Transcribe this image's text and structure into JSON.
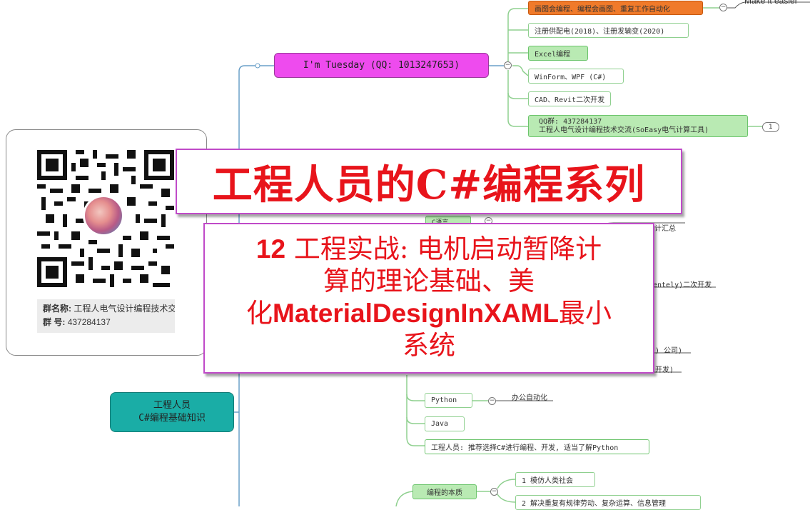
{
  "top_right_text": "Make it easier",
  "central": {
    "label": "I'm Tuesday (QQ: 1013247653)",
    "color": "#ee4bee"
  },
  "top_branches": [
    "画图会编程、编程会画图、重复工作自动化",
    "注册供配电(2018)、注册发输变(2020)",
    "Excel编程",
    "WinForm、WPF (C#)",
    "CAD、Revit二次开发"
  ],
  "qq_group": {
    "line1": "QQ群: 437284137",
    "line2": "工程人电气设计编程技术交流(SoEasy电气计算工具)",
    "badge": "1"
  },
  "left_node": {
    "line1": "工程人员",
    "line2": "C#编程基础知识",
    "color": "#1aada6"
  },
  "partial_labels": {
    "c_lang": "C语言",
    "summary": "计汇总",
    "rentely": "entely)二次开发",
    "company": ") 公司)",
    "kaifa": "开发)"
  },
  "lang_nodes": [
    {
      "label": "Python",
      "note": "办公自动化"
    },
    {
      "label": "Java"
    }
  ],
  "recommend": "工程人员: 推荐选择C#进行编程、开发, 适当了解Python",
  "essence": {
    "label": "编程的本质",
    "items": [
      "1 模仿人类社会",
      "2 解决重复有规律劳动、复杂运算、信息管理"
    ]
  },
  "qr": {
    "group_name_label": "群名称:",
    "group_name": "工程人电气设计编程技术交流",
    "group_no_label": "群  号:",
    "group_no": "437284137"
  },
  "title": "工程人员的C#编程系列",
  "subtitle": {
    "num": "12",
    "line1": "工程实战: 电机启动暂降计",
    "line2": "算的理论基础、美",
    "line3_cn": "化",
    "line3_en": "MaterialDesignInXAML",
    "line3_end": "最小",
    "line4": "系统"
  }
}
